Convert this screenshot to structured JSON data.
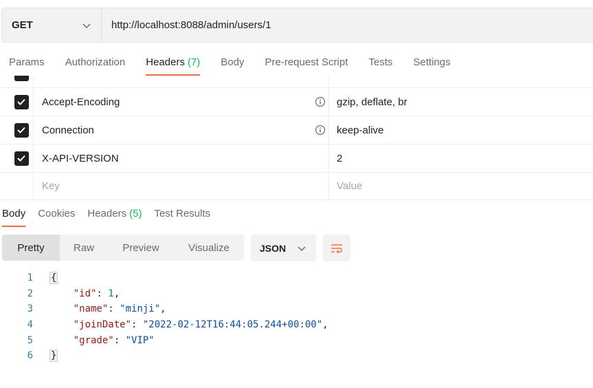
{
  "request": {
    "method": "GET",
    "url": "http://localhost:8088/admin/users/1"
  },
  "request_tabs": [
    {
      "label": "Params"
    },
    {
      "label": "Authorization"
    },
    {
      "label": "Headers",
      "count": "(7)"
    },
    {
      "label": "Body"
    },
    {
      "label": "Pre-request Script"
    },
    {
      "label": "Tests"
    },
    {
      "label": "Settings"
    }
  ],
  "headers": [
    {
      "key": "Accept-Encoding",
      "value": "gzip, deflate, br"
    },
    {
      "key": "Connection",
      "value": "keep-alive"
    },
    {
      "key": "X-API-VERSION",
      "value": "2"
    }
  ],
  "new_header": {
    "key_placeholder": "Key",
    "value_placeholder": "Value"
  },
  "response_tabs": [
    {
      "label": "Body"
    },
    {
      "label": "Cookies"
    },
    {
      "label": "Headers",
      "count": "(5)"
    },
    {
      "label": "Test Results"
    }
  ],
  "format_buttons": [
    "Pretty",
    "Raw",
    "Preview",
    "Visualize"
  ],
  "language": "JSON",
  "response_body": {
    "line_numbers": [
      "1",
      "2",
      "3",
      "4",
      "5",
      "6"
    ],
    "open_brace": "{",
    "close_brace": "}",
    "fields": [
      {
        "key": "\"id\"",
        "value": "1",
        "type": "number",
        "comma": ","
      },
      {
        "key": "\"name\"",
        "value": "\"minji\"",
        "type": "string",
        "comma": ","
      },
      {
        "key": "\"joinDate\"",
        "value": "\"2022-02-12T16:44:05.244+00:00\"",
        "type": "string",
        "comma": ","
      },
      {
        "key": "\"grade\"",
        "value": "\"VIP\"",
        "type": "string",
        "comma": ""
      }
    ]
  },
  "colors": {
    "accent": "#ff6c37",
    "count": "#0cbb52"
  }
}
